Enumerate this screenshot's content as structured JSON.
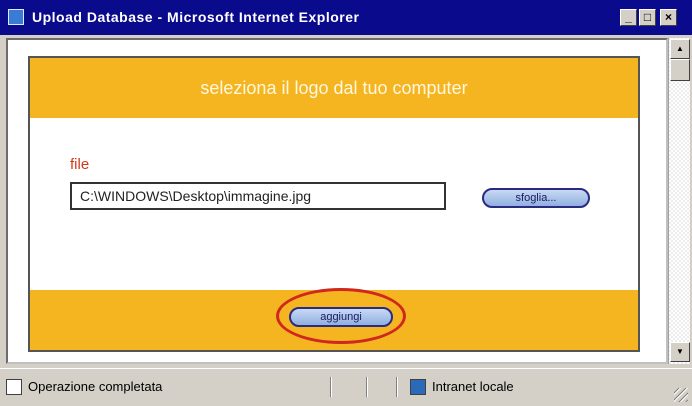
{
  "window": {
    "title": "Upload Database - Microsoft Internet Explorer",
    "controls": [
      "minimize-icon",
      "maximize-icon",
      "close-icon"
    ]
  },
  "panel": {
    "header": "seleziona il logo dal tuo computer",
    "file_label": "file",
    "file_value": "C:\\WINDOWS\\Desktop\\immagine.jpg",
    "browse_label": "sfoglia...",
    "add_label": "aggiungi",
    "colors": {
      "accent": "#f5b520",
      "label": "#d23a1a",
      "highlight": "#d0281e"
    }
  },
  "statusbar": {
    "status_text": "Operazione completata",
    "zone_text": "Intranet locale",
    "icons": [
      "ie-page-icon",
      "intranet-zone-icon"
    ]
  }
}
